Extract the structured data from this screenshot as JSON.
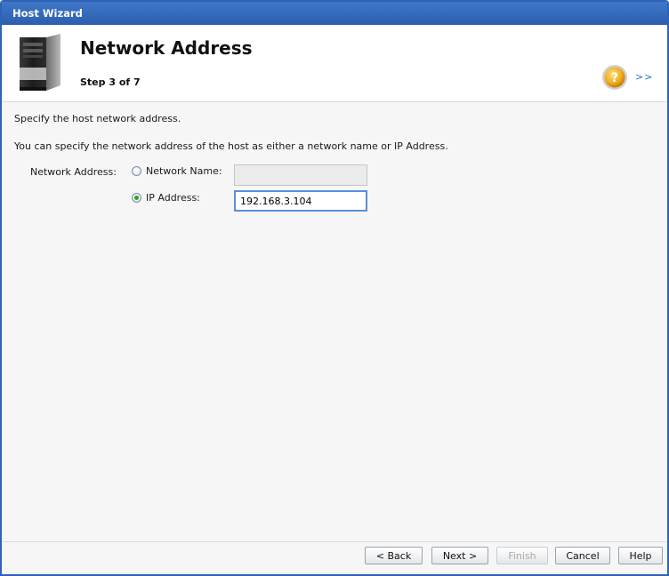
{
  "window": {
    "title": "Host Wizard"
  },
  "header": {
    "title": "Network Address",
    "step": "Step 3 of 7",
    "help_icon": "help-question-icon",
    "expand_label": ">>"
  },
  "body": {
    "description": "Specify the host network address.",
    "instructions": "You can specify the network address of the host as either a network name or IP Address.",
    "network_address_label": "Network Address:",
    "options": {
      "network_name": {
        "label": "Network Name:",
        "selected": false,
        "value": ""
      },
      "ip_address": {
        "label": "IP Address:",
        "selected": true,
        "value": "192.168.3.104"
      }
    }
  },
  "footer": {
    "back_label": "< Back",
    "next_label": "Next >",
    "finish_label": "Finish",
    "cancel_label": "Cancel",
    "help_label": "Help"
  },
  "colors": {
    "titlebar": "#2e63b5",
    "radio_selected": "#2aa52a",
    "focus_border": "#5a8fd8",
    "link": "#2e6fd0"
  }
}
